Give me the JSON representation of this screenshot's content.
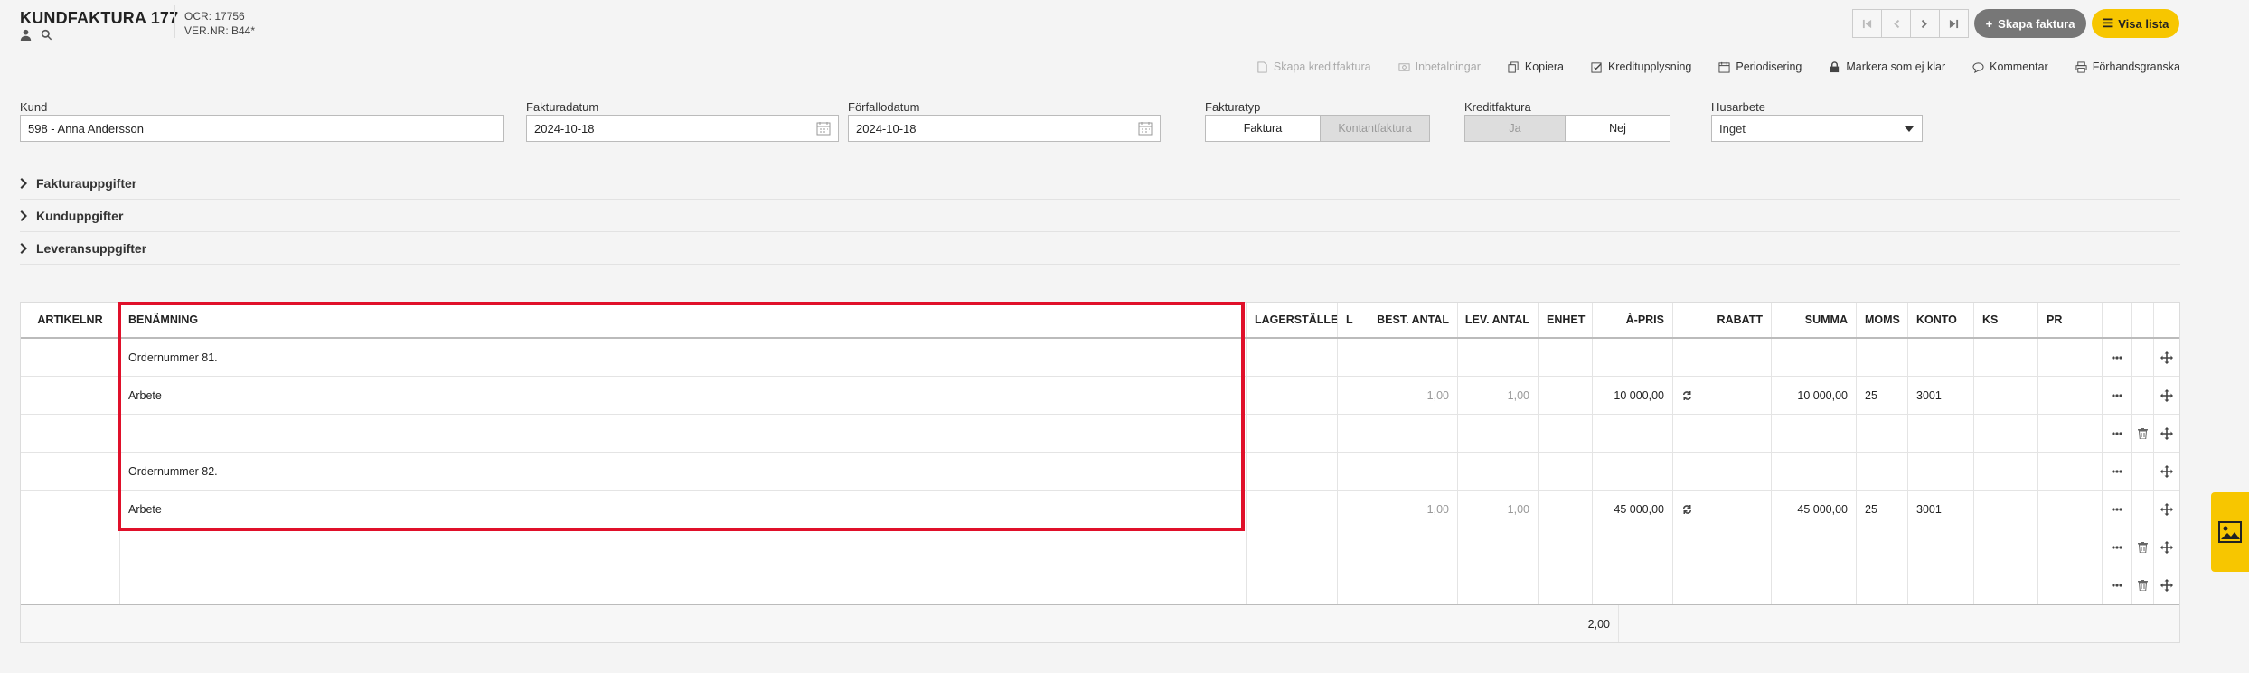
{
  "header": {
    "title": "KUNDFAKTURA 177",
    "ocr": "OCR: 17756",
    "vernr": "VER.NR: B44*",
    "create_button": "Skapa faktura",
    "list_button": "Visa lista"
  },
  "toolbar": {
    "credit_invoice": "Skapa kreditfaktura",
    "payments": "Inbetalningar",
    "copy": "Kopiera",
    "credit_info": "Kreditupplysning",
    "periodize": "Periodisering",
    "mark_not_ready": "Markera som ej klar",
    "comment": "Kommentar",
    "preview": "Förhandsgranska"
  },
  "form": {
    "customer_label": "Kund",
    "customer_value": "598 - Anna Andersson",
    "invoice_date_label": "Fakturadatum",
    "invoice_date_value": "2024-10-18",
    "due_date_label": "Förfallodatum",
    "due_date_value": "2024-10-18",
    "invoice_type_label": "Fakturatyp",
    "invoice_type_options": [
      "Faktura",
      "Kontantfaktura"
    ],
    "credit_label": "Kreditfaktura",
    "credit_options": [
      "Ja",
      "Nej"
    ],
    "housework_label": "Husarbete",
    "housework_value": "Inget"
  },
  "sections": [
    "Fakturauppgifter",
    "Kunduppgifter",
    "Leveransuppgifter"
  ],
  "table": {
    "headers": {
      "artikelnr": "ARTIKELNR",
      "benamning": "BENÄMNING",
      "lagerstalle": "LAGERSTÄLLE",
      "l": "L",
      "best": "BEST. ANTAL",
      "lev": "LEV. ANTAL",
      "enhet": "ENHET",
      "apris": "À-PRIS",
      "rabatt": "RABATT",
      "summa": "SUMMA",
      "moms": "MOMS",
      "konto": "KONTO",
      "ks": "KS",
      "pr": "PR"
    },
    "rows": [
      {
        "benamning": "Ordernummer 81.",
        "best": "",
        "lev": "",
        "apris": "",
        "summa": "",
        "moms": "",
        "konto": ""
      },
      {
        "benamning": "Arbete",
        "best": "1,00",
        "lev": "1,00",
        "apris": "10 000,00",
        "summa": "10 000,00",
        "moms": "25",
        "konto": "3001"
      },
      {
        "benamning": "",
        "best": "",
        "lev": "",
        "apris": "",
        "summa": "",
        "moms": "",
        "konto": ""
      },
      {
        "benamning": "Ordernummer 82.",
        "best": "",
        "lev": "",
        "apris": "",
        "summa": "",
        "moms": "",
        "konto": ""
      },
      {
        "benamning": "Arbete",
        "best": "1,00",
        "lev": "1,00",
        "apris": "45 000,00",
        "summa": "45 000,00",
        "moms": "25",
        "konto": "3001"
      },
      {
        "benamning": "",
        "best": "",
        "lev": "",
        "apris": "",
        "summa": "",
        "moms": "",
        "konto": ""
      },
      {
        "benamning": "",
        "best": "",
        "lev": "",
        "apris": "",
        "summa": "",
        "moms": "",
        "konto": ""
      }
    ],
    "footer_total": "2,00"
  },
  "colors": {
    "accent": "#f7c600",
    "highlight": "#e0102a",
    "dark_button": "#777777"
  }
}
